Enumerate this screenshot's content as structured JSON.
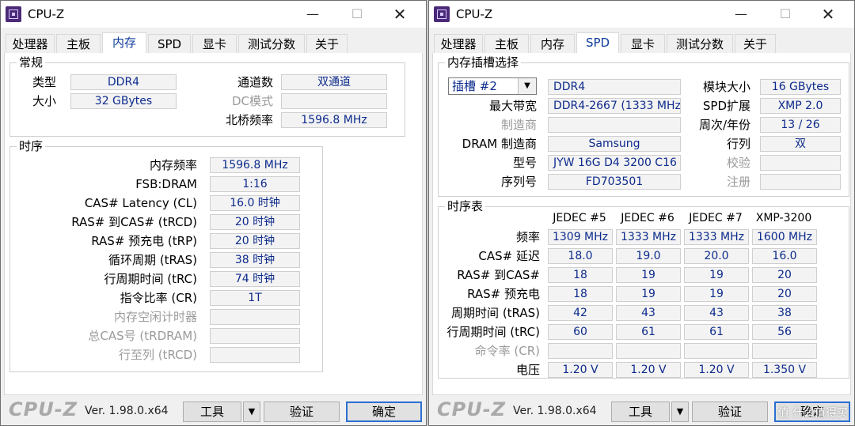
{
  "app_title": "CPU-Z",
  "window_buttons": {
    "minimize": "—",
    "maximize": "☐",
    "close": "✕"
  },
  "tabs": [
    "处理器",
    "主板",
    "内存",
    "SPD",
    "显卡",
    "测试分数",
    "关于"
  ],
  "memory": {
    "general": {
      "legend": "常规",
      "type_label": "类型",
      "type_value": "DDR4",
      "size_label": "大小",
      "size_value": "32 GBytes",
      "channel_label": "通道数",
      "channel_value": "双通道",
      "dc_label": "DC模式",
      "dc_value": "",
      "nb_label": "北桥频率",
      "nb_value": "1596.8 MHz"
    },
    "timings": {
      "legend": "时序",
      "rows": [
        {
          "label": "内存频率",
          "value": "1596.8 MHz",
          "disabled": false
        },
        {
          "label": "FSB:DRAM",
          "value": "1:16",
          "disabled": false
        },
        {
          "label": "CAS# Latency (CL)",
          "value": "16.0 时钟",
          "disabled": false
        },
        {
          "label": "RAS# 到CAS# (tRCD)",
          "value": "20 时钟",
          "disabled": false
        },
        {
          "label": "RAS# 预充电 (tRP)",
          "value": "20 时钟",
          "disabled": false
        },
        {
          "label": "循环周期 (tRAS)",
          "value": "38 时钟",
          "disabled": false
        },
        {
          "label": "行周期时间 (tRC)",
          "value": "74 时钟",
          "disabled": false
        },
        {
          "label": "指令比率 (CR)",
          "value": "1T",
          "disabled": false
        },
        {
          "label": "内存空闲计时器",
          "value": "",
          "disabled": true
        },
        {
          "label": "总CAS号 (tRDRAM)",
          "value": "",
          "disabled": true
        },
        {
          "label": "行至列 (tRCD)",
          "value": "",
          "disabled": true
        }
      ]
    }
  },
  "spd": {
    "slot": {
      "legend": "内存插槽选择",
      "select_value": "插槽 #2",
      "type_value": "DDR4",
      "max_bw_label": "最大带宽",
      "max_bw_value": "DDR4-2667 (1333 MHz)",
      "maker_label": "制造商",
      "maker_value": "",
      "dram_maker_label": "DRAM 制造商",
      "dram_maker_value": "Samsung",
      "model_label": "型号",
      "model_value": "JYW 16G D4 3200 C16",
      "serial_label": "序列号",
      "serial_value": "FD703501",
      "module_size_label": "模块大小",
      "module_size_value": "16 GBytes",
      "spd_ext_label": "SPD扩展",
      "spd_ext_value": "XMP 2.0",
      "week_year_label": "周次/年份",
      "week_year_value": "13 / 26",
      "ranks_label": "行列",
      "ranks_value": "双",
      "verify_label": "校验",
      "verify_value": "",
      "registered_label": "注册",
      "registered_value": ""
    },
    "timing_table": {
      "legend": "时序表",
      "columns": [
        "JEDEC #5",
        "JEDEC #6",
        "JEDEC #7",
        "XMP-3200"
      ],
      "rows": [
        {
          "label": "频率",
          "values": [
            "1309 MHz",
            "1333 MHz",
            "1333 MHz",
            "1600 MHz"
          ],
          "disabled": false
        },
        {
          "label": "CAS# 延迟",
          "values": [
            "18.0",
            "19.0",
            "20.0",
            "16.0"
          ],
          "disabled": false
        },
        {
          "label": "RAS# 到CAS#",
          "values": [
            "18",
            "19",
            "19",
            "20"
          ],
          "disabled": false
        },
        {
          "label": "RAS# 预充电",
          "values": [
            "18",
            "19",
            "19",
            "20"
          ],
          "disabled": false
        },
        {
          "label": "周期时间 (tRAS)",
          "values": [
            "42",
            "43",
            "43",
            "38"
          ],
          "disabled": false
        },
        {
          "label": "行周期时间 (tRC)",
          "values": [
            "60",
            "61",
            "61",
            "56"
          ],
          "disabled": false
        },
        {
          "label": "命令率 (CR)",
          "values": [
            "",
            "",
            "",
            ""
          ],
          "disabled": true
        },
        {
          "label": "电压",
          "values": [
            "1.20 V",
            "1.20 V",
            "1.20 V",
            "1.350 V"
          ],
          "disabled": false
        }
      ]
    }
  },
  "footer": {
    "brand": "CPU-Z",
    "version": "Ver. 1.98.0.x64",
    "tools_label": "工具",
    "validate_label": "验证",
    "ok_label": "确定"
  },
  "watermark": "值 什么值得买"
}
